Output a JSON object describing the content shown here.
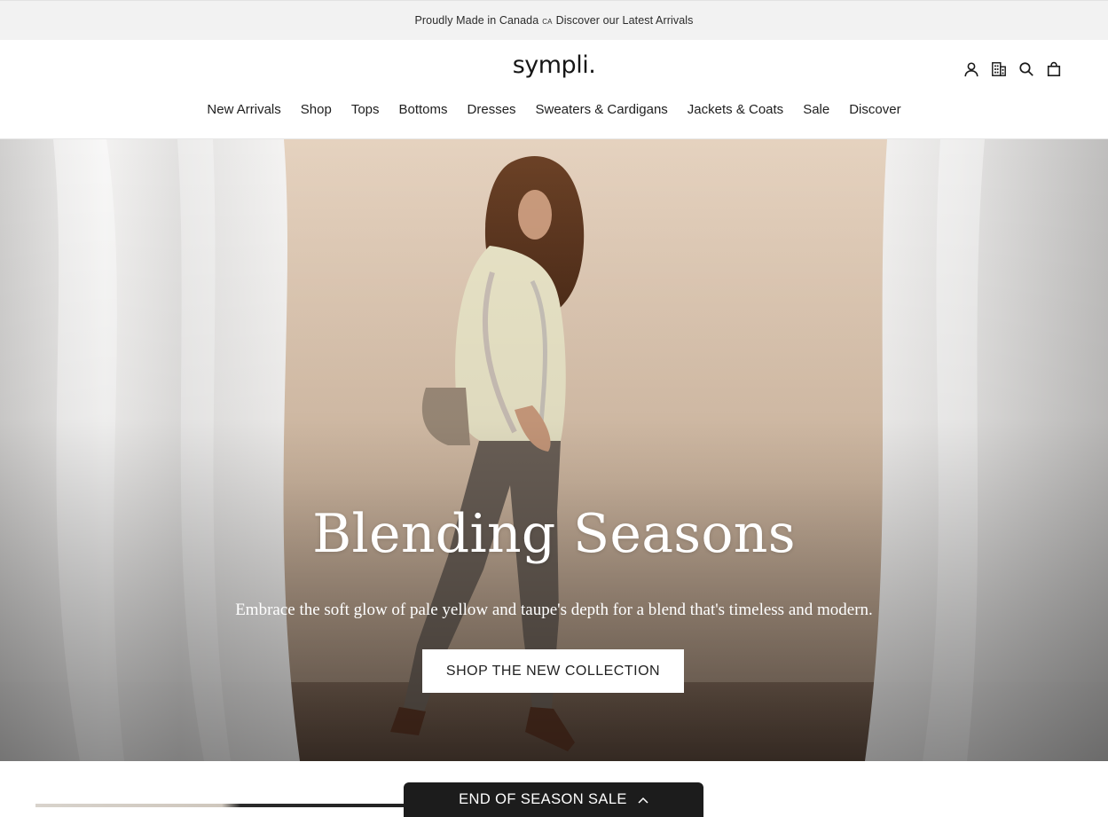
{
  "announcement": {
    "text_part1": "Proudly Made in Canada",
    "country_code": "CA",
    "link_text": "Discover our Latest Arrivals"
  },
  "header": {
    "logo": "sympli.",
    "icons": [
      "account-icon",
      "store-locator-icon",
      "search-icon",
      "cart-icon"
    ]
  },
  "nav": {
    "items": [
      {
        "label": "New Arrivals"
      },
      {
        "label": "Shop"
      },
      {
        "label": "Tops"
      },
      {
        "label": "Bottoms"
      },
      {
        "label": "Dresses"
      },
      {
        "label": "Sweaters & Cardigans"
      },
      {
        "label": "Jackets & Coats"
      },
      {
        "label": "Sale"
      },
      {
        "label": "Discover"
      }
    ]
  },
  "hero": {
    "title": "Blending Seasons",
    "subtitle": "Embrace the soft glow of pale yellow and taupe's depth for a blend that's timeless and modern.",
    "button_label": "SHOP THE NEW COLLECTION"
  },
  "sale_bar": {
    "label": "END OF SEASON SALE",
    "icon": "chevron-up-icon"
  },
  "colors": {
    "announcement_bg": "#f2f2f2",
    "hero_wall": "#d9c3ae",
    "sale_bar_bg": "#1c1c1c",
    "button_bg": "#ffffff"
  }
}
